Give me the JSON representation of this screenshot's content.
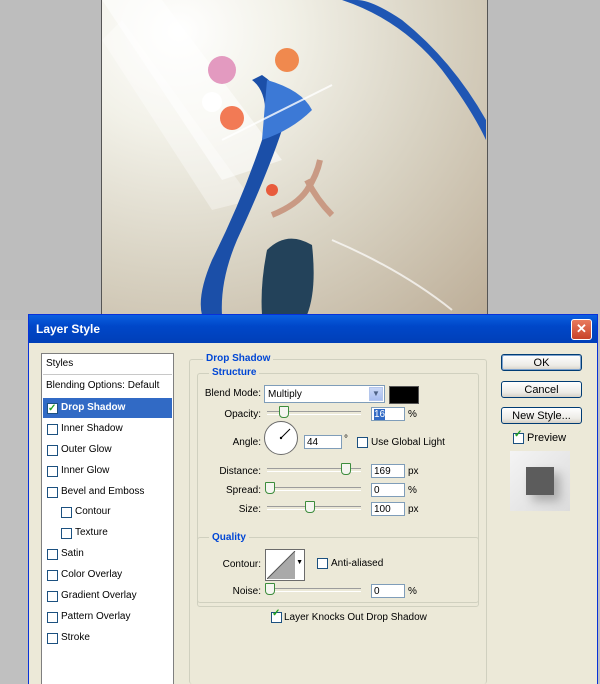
{
  "dialog": {
    "title": "Layer Style"
  },
  "styles_list": {
    "header": "Styles",
    "blending_options": "Blending Options: Default",
    "items": [
      {
        "label": "Drop Shadow",
        "checked": true,
        "selected": true
      },
      {
        "label": "Inner Shadow",
        "checked": false
      },
      {
        "label": "Outer Glow",
        "checked": false
      },
      {
        "label": "Inner Glow",
        "checked": false
      },
      {
        "label": "Bevel and Emboss",
        "checked": false
      },
      {
        "label": "Contour",
        "checked": false
      },
      {
        "label": "Texture",
        "checked": false
      },
      {
        "label": "Satin",
        "checked": false
      },
      {
        "label": "Color Overlay",
        "checked": false
      },
      {
        "label": "Gradient Overlay",
        "checked": false
      },
      {
        "label": "Pattern Overlay",
        "checked": false
      },
      {
        "label": "Stroke",
        "checked": false
      }
    ]
  },
  "drop_shadow": {
    "section_title": "Drop Shadow",
    "structure_title": "Structure",
    "blend_mode_label": "Blend Mode:",
    "blend_mode_value": "Multiply",
    "shadow_color": "#000000",
    "opacity_label": "Opacity:",
    "opacity_value": "16",
    "opacity_unit": "%",
    "angle_label": "Angle:",
    "angle_value": "44",
    "angle_unit": "°",
    "use_global_light_label": "Use Global Light",
    "use_global_light": false,
    "distance_label": "Distance:",
    "distance_value": "169",
    "distance_unit": "px",
    "spread_label": "Spread:",
    "spread_value": "0",
    "spread_unit": "%",
    "size_label": "Size:",
    "size_value": "100",
    "size_unit": "px",
    "quality_title": "Quality",
    "contour_label": "Contour:",
    "anti_aliased_label": "Anti-aliased",
    "anti_aliased": false,
    "noise_label": "Noise:",
    "noise_value": "0",
    "noise_unit": "%",
    "knocks_out_label": "Layer Knocks Out Drop Shadow",
    "knocks_out": true
  },
  "buttons": {
    "ok": "OK",
    "cancel": "Cancel",
    "new_style": "New Style...",
    "preview_label": "Preview",
    "preview_checked": true
  },
  "colors": {
    "title_bar": "#0a5fe0",
    "selection": "#316ac5",
    "group_title": "#0046d5"
  }
}
